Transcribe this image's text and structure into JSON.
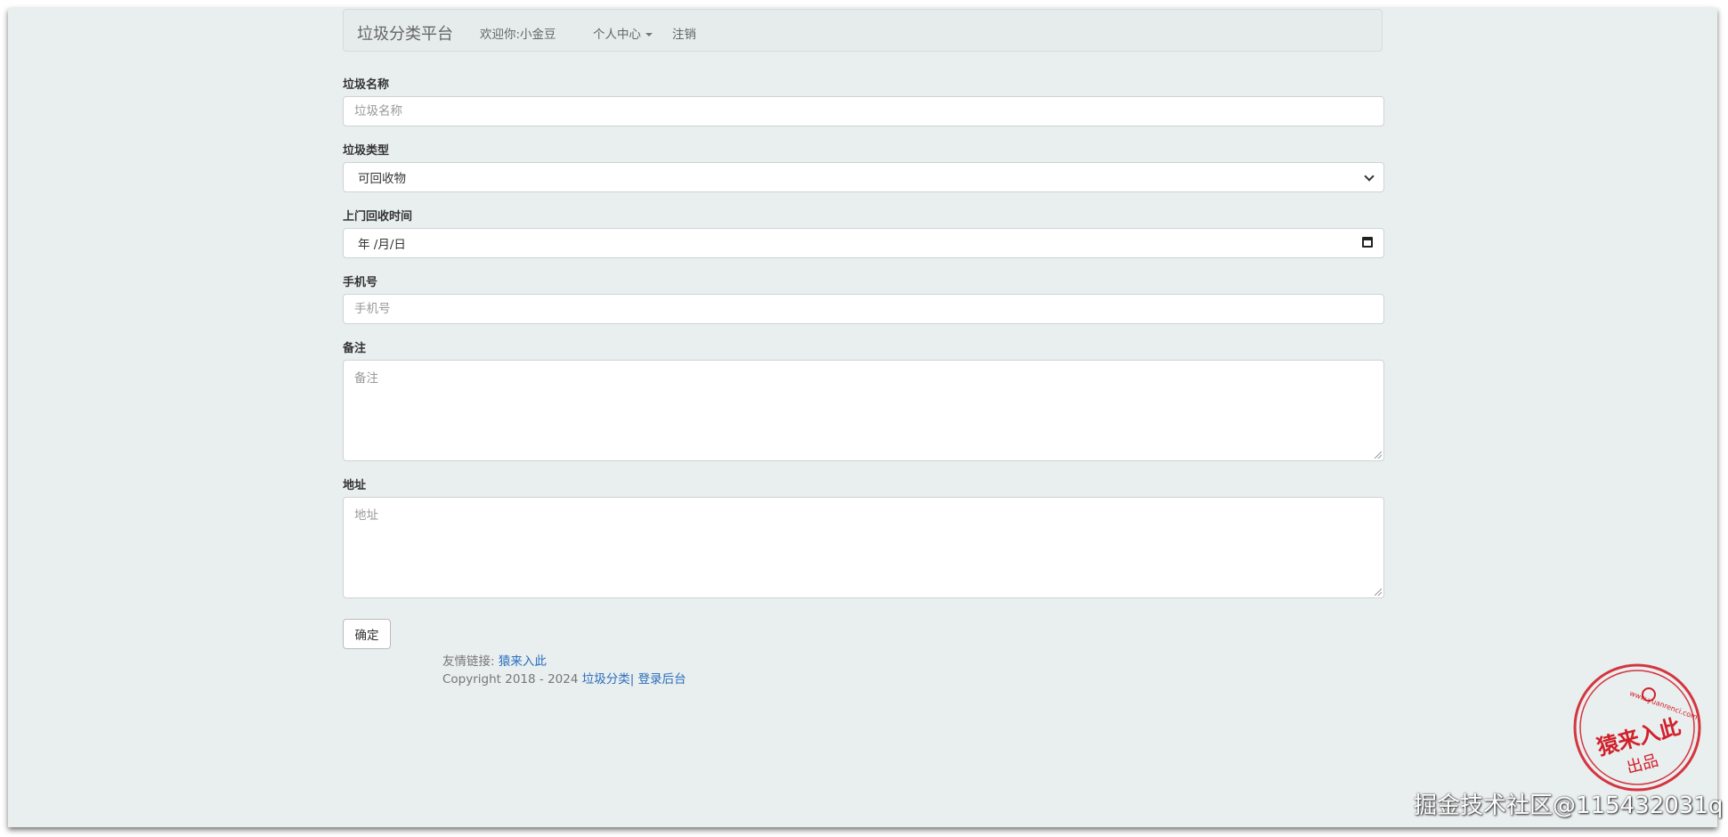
{
  "navbar": {
    "brand": "垃圾分类平台",
    "welcome": "欢迎你:小金豆",
    "personal_center": "个人中心",
    "logout": "注销"
  },
  "form": {
    "name": {
      "label": "垃圾名称",
      "placeholder": "垃圾名称"
    },
    "type": {
      "label": "垃圾类型",
      "value": "可回收物"
    },
    "pickup_time": {
      "label": "上门回收时间",
      "value": "年 /月/日"
    },
    "phone": {
      "label": "手机号",
      "placeholder": "手机号"
    },
    "remark": {
      "label": "备注",
      "placeholder": "备注"
    },
    "address": {
      "label": "地址",
      "placeholder": "地址"
    },
    "submit_label": "确定"
  },
  "footer": {
    "friend_links_prefix": "友情链接:",
    "friend_link": "猿来入此",
    "copyright": "Copyright 2018 - 2024",
    "link_category": "垃圾分类|",
    "link_admin": "登录后台"
  },
  "stamp": {
    "main_text": "猿来入此",
    "sub_text": "出品",
    "url": "www.yuanrenci.com"
  },
  "watermark": "掘金技术社区@115432031q"
}
